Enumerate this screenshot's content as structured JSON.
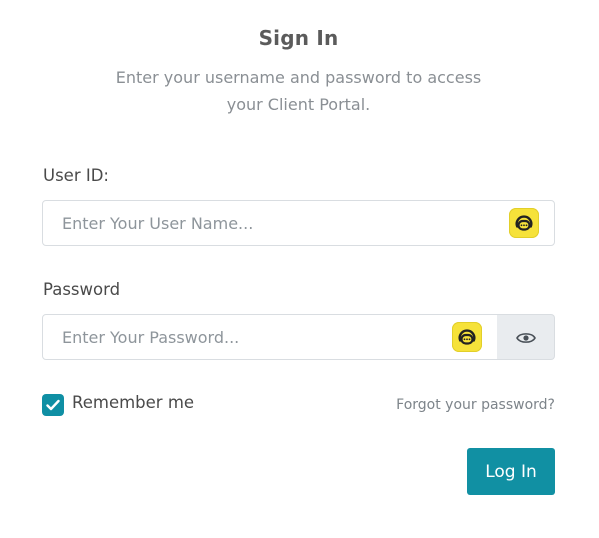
{
  "header": {
    "title": "Sign In",
    "subtitle_line1": "Enter your username and password to access",
    "subtitle_line2": "your Client Portal."
  },
  "form": {
    "user_id": {
      "label": "User ID:",
      "placeholder": "Enter Your User Name...",
      "value": "",
      "extension_icon": "password-manager-icon"
    },
    "password": {
      "label": "Password",
      "placeholder": "Enter Your Password...",
      "value": "",
      "extension_icon": "password-manager-icon",
      "toggle_icon": "eye-icon"
    },
    "remember_me": {
      "label": "Remember me",
      "checked": true
    },
    "forgot_password_label": "Forgot your password?",
    "submit_label": "Log In"
  },
  "colors": {
    "accent": "#1190a3",
    "checkbox": "#0f8fa4",
    "extension_icon_bg": "#f6e23a",
    "title": "#5b5b5b",
    "muted_text": "#8a8f94"
  }
}
